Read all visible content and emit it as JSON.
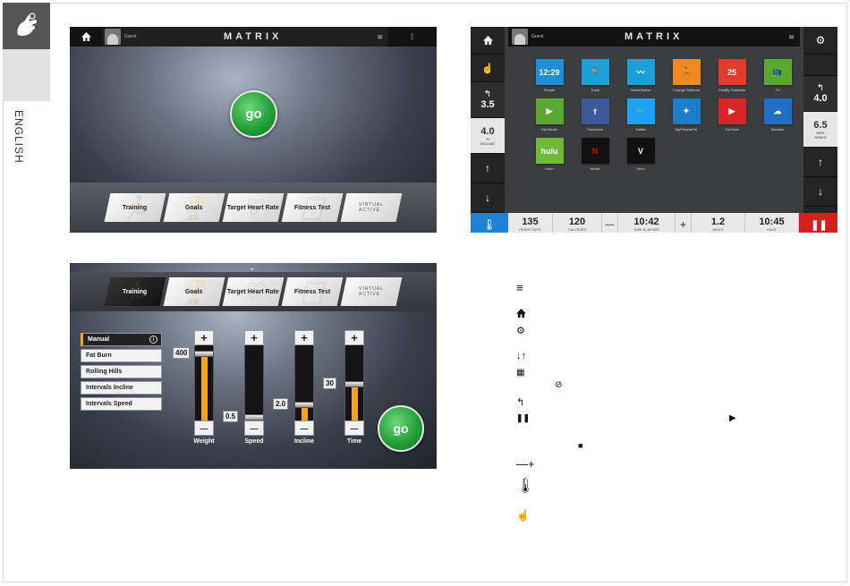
{
  "sidebar": {
    "language": "ENGLISH"
  },
  "screen1": {
    "user": "Guest",
    "brand": "MATRIX",
    "go": "go",
    "tabs": [
      "Training",
      "Goals",
      "Target Heart Rate",
      "Fitness Test"
    ],
    "virtual_active": [
      "VIRTUAL",
      "ACTIVE"
    ]
  },
  "screen2": {
    "user": "Guest",
    "brand": "MATRIX",
    "left": {
      "back_value": "3.5",
      "incline_value": "4.0",
      "incline_unit": "%",
      "incline_label": "INCLINE"
    },
    "right": {
      "back_value": "4.0",
      "speed_value": "6.5",
      "speed_unit": "mph",
      "speed_label": "SPEED"
    },
    "apps": [
      {
        "label": "Simple",
        "glyph": "12:29",
        "color": "#1c8fd6"
      },
      {
        "label": "Track",
        "glyph": "🏃",
        "color": "#1c9fd6"
      },
      {
        "label": "Virtual Active",
        "glyph": "〰",
        "color": "#1c9fd6"
      },
      {
        "label": "Change Workout",
        "glyph": "🏃",
        "color": "#f08a1e"
      },
      {
        "label": "Facility Calendar",
        "glyph": "25",
        "color": "#e23b2e"
      },
      {
        "label": "TV",
        "glyph": "📺",
        "color": "#5aa832"
      },
      {
        "label": "My Media",
        "glyph": "▶",
        "color": "#5aa832"
      },
      {
        "label": "Facebook",
        "glyph": "f",
        "color": "#3b5998"
      },
      {
        "label": "Twitter",
        "glyph": "🐦",
        "color": "#1da1f2"
      },
      {
        "label": "MyFitnessPal",
        "glyph": "✦",
        "color": "#1a7fc6"
      },
      {
        "label": "YouTube",
        "glyph": "▶",
        "color": "#d92525"
      },
      {
        "label": "Weather",
        "glyph": "☁",
        "color": "#1f6fc6"
      },
      {
        "label": "Hulu+",
        "glyph": "hulu",
        "color": "#6fb83a"
      },
      {
        "label": "Netflix",
        "glyph": "N",
        "color": "#111111"
      },
      {
        "label": "Vevo",
        "glyph": "V",
        "color": "#111111"
      }
    ],
    "bottom": {
      "heart_rate": "135",
      "heart_rate_label": "HEART RATE",
      "calories": "120",
      "calories_label": "CALORIES",
      "minus": "—",
      "time": "10:42",
      "time_label": "TIME ELAPSED",
      "plus": "+",
      "miles": "1.2",
      "miles_label": "MILES",
      "pace": "10:45",
      "pace_label": "PACE",
      "progress": 0.35
    }
  },
  "screen3": {
    "tabs": [
      "Training",
      "Goals",
      "Target Heart Rate",
      "Fitness Test"
    ],
    "virtual_active": [
      "VIRTUAL",
      "ACTIVE"
    ],
    "list": [
      "Manual",
      "Fat Burn",
      "Rolling Hills",
      "Intervals Incline",
      "Intervals Speed"
    ],
    "sliders": [
      {
        "label": "Weight",
        "value": "400",
        "fill": 0.88
      },
      {
        "label": "Speed",
        "value": "0.5",
        "fill": 0.04
      },
      {
        "label": "Incline",
        "value": "2.0",
        "fill": 0.2
      },
      {
        "label": "Time",
        "value": "30",
        "fill": 0.48
      }
    ],
    "go": "go",
    "plus": "+",
    "minus": "—"
  },
  "legend": {
    "dash_plus": "—+"
  },
  "colors": {
    "accent": "#f4a41c",
    "go_green": "#1f9c33",
    "pause_red": "#d62020",
    "hr_blue": "#1f82d2"
  }
}
